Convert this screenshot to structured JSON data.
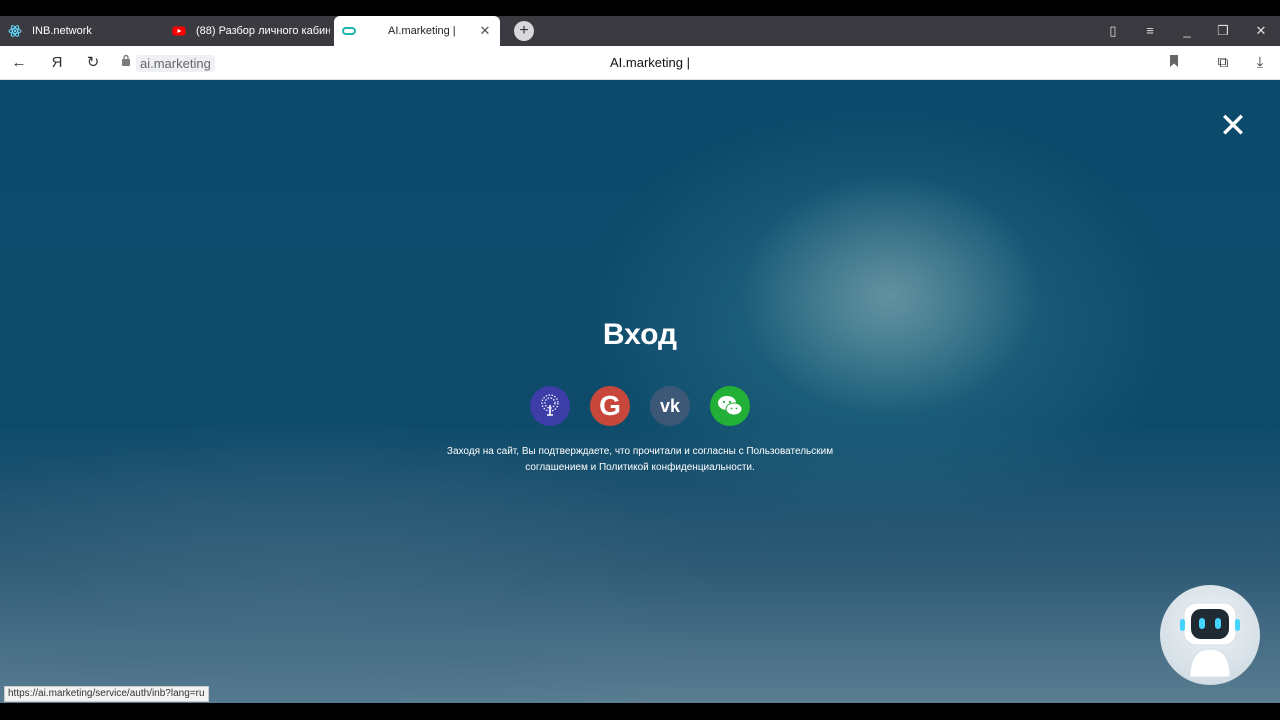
{
  "browser": {
    "tabs": [
      {
        "label": "INB.network",
        "icon": "react-icon"
      },
      {
        "label": "(88) Разбор личного кабине",
        "icon": "youtube-icon"
      },
      {
        "label": "AI.marketing |",
        "icon": "ai-marketing-icon",
        "active": true
      }
    ],
    "address": {
      "host": "ai.marketing"
    },
    "page_title": "AI.marketing |",
    "status_url": "https://ai.marketing/service/auth/inb?lang=ru"
  },
  "login": {
    "title": "Вход",
    "providers": [
      {
        "name": "INB",
        "icon": "inb-tree-icon",
        "color": "#3d3da8"
      },
      {
        "name": "Google",
        "icon": "google-icon",
        "glyph": "G",
        "color": "#c7473a"
      },
      {
        "name": "VK",
        "icon": "vk-icon",
        "glyph": "vk",
        "color": "#3d5876"
      },
      {
        "name": "WeChat",
        "icon": "wechat-icon",
        "color": "#22b037"
      }
    ],
    "consent_line1": "Заходя на сайт, Вы подтверждаете, что прочитали и согласны с Пользовательским",
    "consent_line2": "соглашением и Политикой конфиденциальности."
  },
  "widget": {
    "icon": "robot-assistant-icon"
  }
}
